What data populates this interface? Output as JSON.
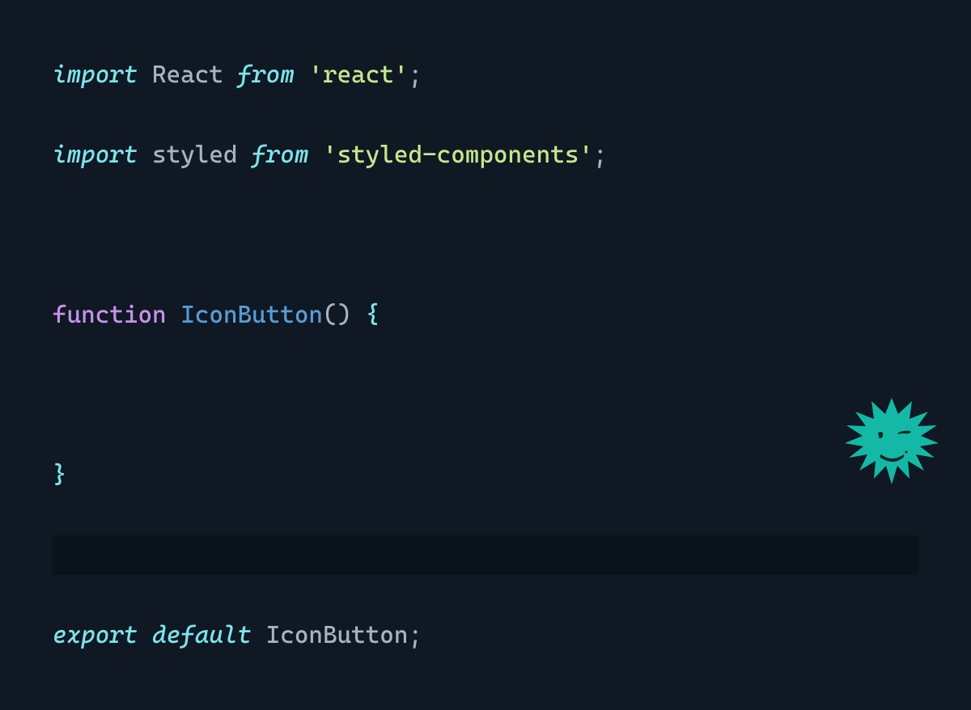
{
  "code": {
    "line1": {
      "import": "import",
      "react": "React",
      "from": "from",
      "module": "'react'",
      "semi": ";"
    },
    "line2": {
      "import": "import",
      "styled": "styled",
      "from": "from",
      "module": "'styled-components'",
      "semi": ";"
    },
    "line4": {
      "function": "function",
      "name": "IconButton",
      "parens": "()",
      "brace_open": "{"
    },
    "line6": {
      "brace_close": "}"
    },
    "line8": {
      "export": "export",
      "default": "default",
      "name": "IconButton",
      "semi": ";"
    }
  },
  "colors": {
    "background": "#0f1823",
    "keyword_italic": "#7ee3ea",
    "identifier": "#aab2bf",
    "string": "#c3e88d",
    "function_keyword": "#c792ea",
    "function_name": "#5a9bd4",
    "brace": "#7ee3ea",
    "logo": "#14b8a6"
  }
}
